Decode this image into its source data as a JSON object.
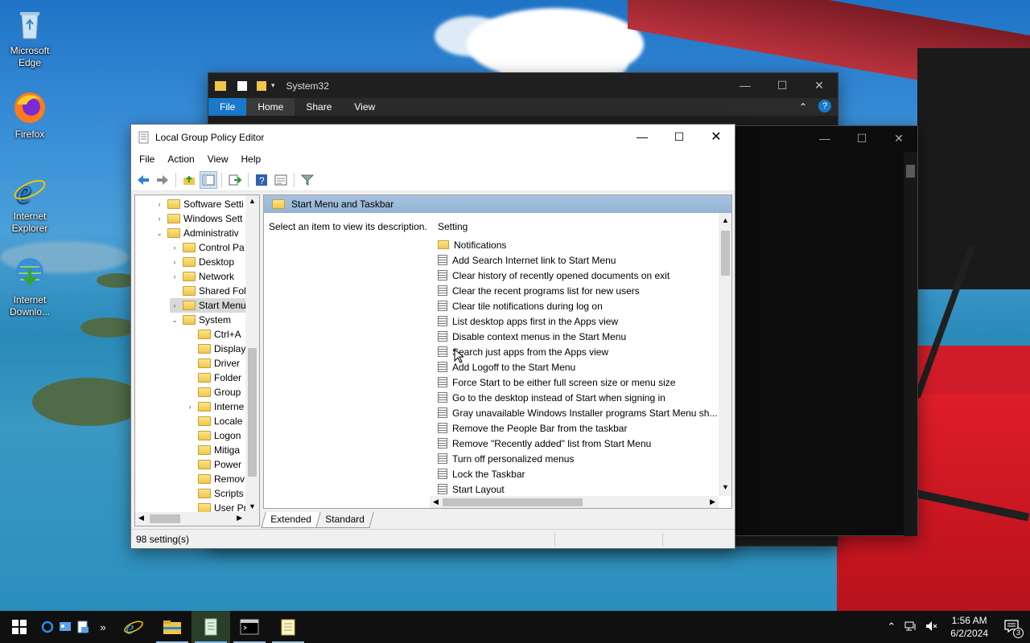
{
  "desktop": {
    "icons": [
      {
        "label": "Microsoft Edge",
        "icon": "recycle-bin-icon"
      },
      {
        "label": "Firefox",
        "icon": "firefox-icon"
      },
      {
        "label": "Internet Explorer",
        "icon": "internet-explorer-icon"
      },
      {
        "label": "Internet Downlo...",
        "icon": "internet-download-manager-icon"
      }
    ]
  },
  "explorer": {
    "title": "System32",
    "ribbon_tabs": [
      "File",
      "Home",
      "Share",
      "View"
    ]
  },
  "gpedit": {
    "title": "Local Group Policy Editor",
    "menu": [
      "File",
      "Action",
      "View",
      "Help"
    ],
    "tree": [
      {
        "label": "Software Setti",
        "indent": 0,
        "expander": "›"
      },
      {
        "label": "Windows Sett",
        "indent": 0,
        "expander": "›"
      },
      {
        "label": "Administrativ",
        "indent": 0,
        "expander": "⌄"
      },
      {
        "label": "Control Pa",
        "indent": 1,
        "expander": "›"
      },
      {
        "label": "Desktop",
        "indent": 1,
        "expander": "›"
      },
      {
        "label": "Network",
        "indent": 1,
        "expander": "›"
      },
      {
        "label": "Shared Fol",
        "indent": 1,
        "expander": ""
      },
      {
        "label": "Start Menu",
        "indent": 1,
        "expander": "›",
        "selected": true
      },
      {
        "label": "System",
        "indent": 1,
        "expander": "⌄"
      },
      {
        "label": "Ctrl+A",
        "indent": 2,
        "expander": ""
      },
      {
        "label": "Display",
        "indent": 2,
        "expander": ""
      },
      {
        "label": "Driver",
        "indent": 2,
        "expander": ""
      },
      {
        "label": "Folder",
        "indent": 2,
        "expander": ""
      },
      {
        "label": "Group",
        "indent": 2,
        "expander": ""
      },
      {
        "label": "Interne",
        "indent": 2,
        "expander": "›"
      },
      {
        "label": "Locale",
        "indent": 2,
        "expander": ""
      },
      {
        "label": "Logon",
        "indent": 2,
        "expander": ""
      },
      {
        "label": "Mitiga",
        "indent": 2,
        "expander": ""
      },
      {
        "label": "Power",
        "indent": 2,
        "expander": ""
      },
      {
        "label": "Remov",
        "indent": 2,
        "expander": ""
      },
      {
        "label": "Scripts",
        "indent": 2,
        "expander": ""
      },
      {
        "label": "User Pr",
        "indent": 2,
        "expander": ""
      }
    ],
    "pane_header": "Start Menu and Taskbar",
    "description": "Select an item to view its description.",
    "column_header": "Setting",
    "settings": [
      {
        "label": "Notifications",
        "type": "folder"
      },
      {
        "label": "Add Search Internet link to Start Menu",
        "type": "policy"
      },
      {
        "label": "Clear history of recently opened documents on exit",
        "type": "policy"
      },
      {
        "label": "Clear the recent programs list for new users",
        "type": "policy"
      },
      {
        "label": "Clear tile notifications during log on",
        "type": "policy"
      },
      {
        "label": "List desktop apps first in the Apps view",
        "type": "policy"
      },
      {
        "label": "Disable context menus in the Start Menu",
        "type": "policy"
      },
      {
        "label": "Search just apps from the Apps view",
        "type": "policy"
      },
      {
        "label": "Add Logoff to the Start Menu",
        "type": "policy"
      },
      {
        "label": "Force Start to be either full screen size or menu size",
        "type": "policy"
      },
      {
        "label": "Go to the desktop instead of Start when signing in",
        "type": "policy"
      },
      {
        "label": "Gray unavailable Windows Installer programs Start Menu sh...",
        "type": "policy"
      },
      {
        "label": "Remove the People Bar from the taskbar",
        "type": "policy"
      },
      {
        "label": "Remove \"Recently added\" list from Start Menu",
        "type": "policy"
      },
      {
        "label": "Turn off personalized menus",
        "type": "policy"
      },
      {
        "label": "Lock the Taskbar",
        "type": "policy"
      },
      {
        "label": "Start Layout",
        "type": "policy"
      }
    ],
    "tabs": [
      "Extended",
      "Standard"
    ],
    "active_tab": "Extended",
    "status": "98 setting(s)"
  },
  "taskbar": {
    "time": "1:56 AM",
    "date": "6/2/2024",
    "notification_count": "3",
    "overflow_label": "»"
  },
  "colors": {
    "header_band": "#a8c3df",
    "taskbar": "#101010",
    "accent": "#1979ca"
  }
}
